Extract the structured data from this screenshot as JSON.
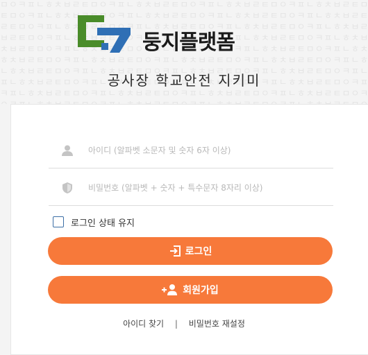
{
  "brand": {
    "name": "둥지플랫폼",
    "subtitle": "공사장 학교안전 지키미",
    "colors": {
      "green": "#4a8c2a",
      "blue": "#2f6fb5",
      "accent": "#f7793a"
    }
  },
  "login_form": {
    "id_field": {
      "placeholder": "아이디 (알파벳 소문자 및 숫자 6자 이상)",
      "value": "",
      "icon": "user-icon"
    },
    "password_field": {
      "placeholder": "비밀번호 (알파벳 + 숫자 + 특수문자 8자리 이상)",
      "value": "",
      "icon": "shield-icon"
    },
    "remember": {
      "label": "로그인 상태 유지",
      "checked": false
    },
    "login_button": {
      "label": "로그인",
      "icon": "login-icon"
    },
    "signup_button": {
      "label": "회원가입",
      "icon": "add-user-icon"
    },
    "links": {
      "find_id": "아이디 찾기",
      "separator": "|",
      "reset_password": "비밀번호 재설정"
    }
  }
}
